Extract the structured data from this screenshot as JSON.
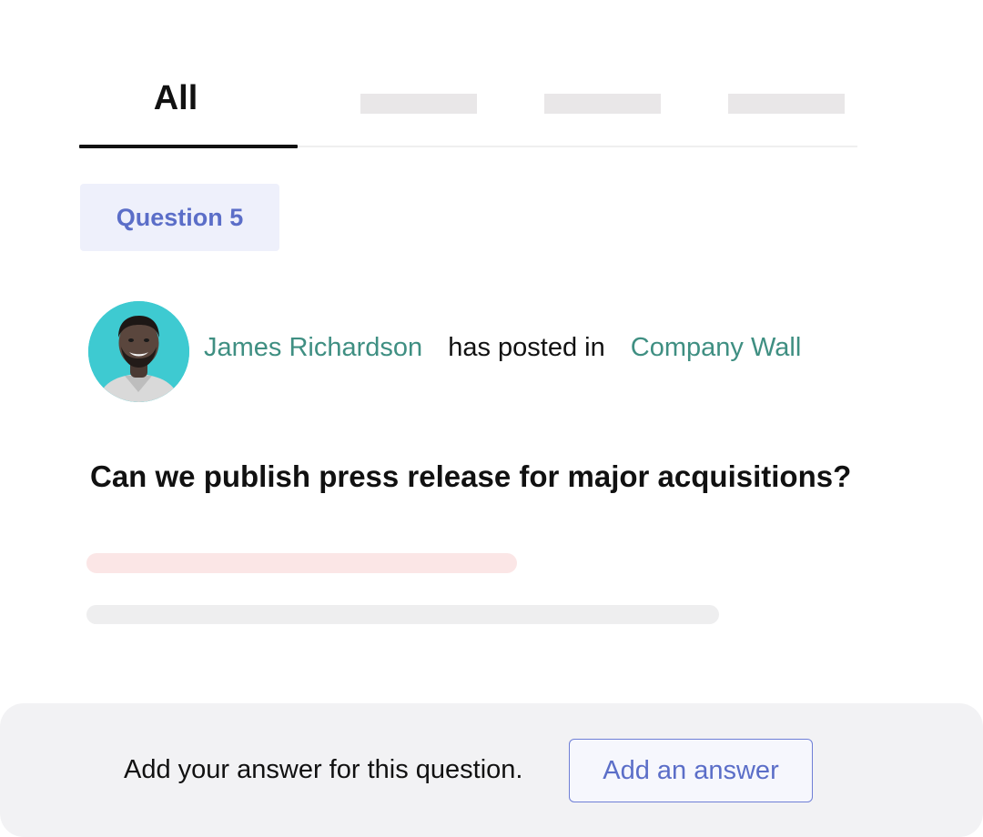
{
  "tabs": {
    "active_label": "All"
  },
  "question_badge": "Question 5",
  "post": {
    "author": "James Richardson",
    "action": "has posted in",
    "group": "Company Wall"
  },
  "question_text": "Can we publish press release for major acquisitions?",
  "answer_bar": {
    "prompt": "Add your answer for this question.",
    "button_label": "Add an answer"
  },
  "colors": {
    "accent_link": "#3f8f82",
    "badge_text": "#5b6ec8",
    "button_border": "#6f7fd6",
    "avatar_bg": "#3ecad1"
  },
  "icons": {
    "avatar": "user-photo-avatar"
  }
}
